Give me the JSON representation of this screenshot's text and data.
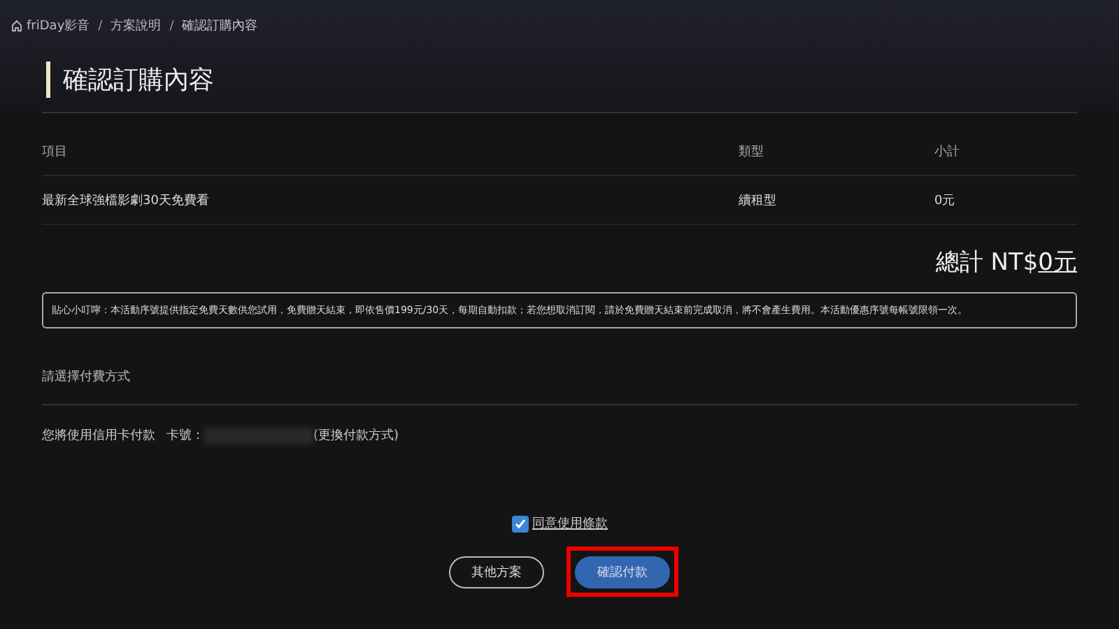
{
  "breadcrumb": [
    {
      "label": "friDay影音",
      "kind": "home"
    },
    {
      "label": "方案說明",
      "kind": "link"
    },
    {
      "label": "確認訂購內容",
      "kind": "current"
    }
  ],
  "breadcrumb_separator": "/",
  "page_title": "確認訂購內容",
  "table": {
    "columns": [
      "項目",
      "類型",
      "小計"
    ],
    "rows": [
      [
        "最新全球強檔影劇30天免費看",
        "續租型",
        "0元"
      ]
    ]
  },
  "total": {
    "label": "總計 NT$",
    "amount": "0元"
  },
  "notice": "貼心小叮嚀：本活動序號提供指定免費天數供您試用，免費贈天結束，即依售價199元/30天，每期自動扣款；若您想取消訂閱，請於免費贈天結束前完成取消，將不會產生費用。本活動優惠序號每帳號限領一次。",
  "payment": {
    "heading": "請選擇付費方式",
    "method": "您將使用信用卡付款",
    "card_label": "卡號：",
    "card_masked": true,
    "change_link": "(更換付款方式)"
  },
  "agree": {
    "label": "同意使用條款",
    "checked": true
  },
  "buttons": [
    {
      "label": "其他方案",
      "kind": "outline",
      "highlighted": false
    },
    {
      "label": "確認付款",
      "kind": "primary",
      "highlighted": true
    }
  ]
}
